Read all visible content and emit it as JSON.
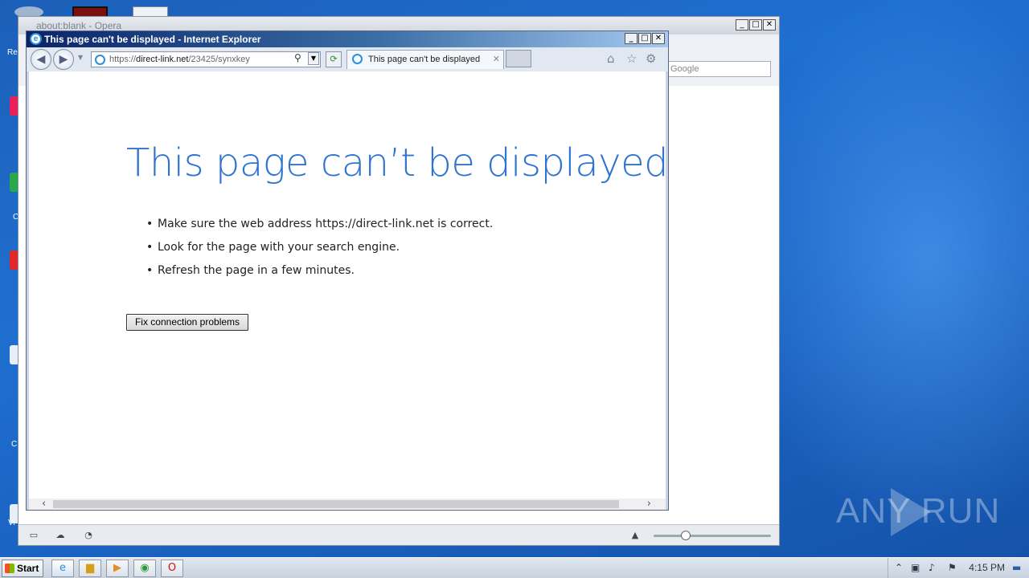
{
  "desktop": {
    "labels": [
      "Re",
      "C",
      "C",
      "Vi"
    ]
  },
  "opera": {
    "title": "about:blank - Opera",
    "search_placeholder": "Google",
    "controls": [
      "_",
      "□",
      "✕"
    ],
    "status_icons": [
      "panel-icon",
      "cloud-icon",
      "speed-dial-icon",
      "up-arrow-icon"
    ]
  },
  "ie": {
    "title": "This page can't be displayed - Internet Explorer",
    "controls": [
      "_",
      "□",
      "✕"
    ],
    "address": {
      "scheme": "https://",
      "host": "direct-link.net",
      "path": "/23425/synxkey"
    },
    "tab_title": "This page can't be displayed",
    "page": {
      "heading": "This page can’t be displayed",
      "bullets": [
        "Make sure the web address https://direct-link.net is correct.",
        "Look for the page with your search engine.",
        "Refresh the page in a few minutes."
      ],
      "fix_button": "Fix connection problems"
    }
  },
  "watermark": "ANY RUN",
  "taskbar": {
    "start_label": "Start",
    "clock": "4:15 PM",
    "apps": [
      "ie-icon",
      "folder-icon",
      "media-player-icon",
      "chrome-icon",
      "opera-icon"
    ]
  }
}
